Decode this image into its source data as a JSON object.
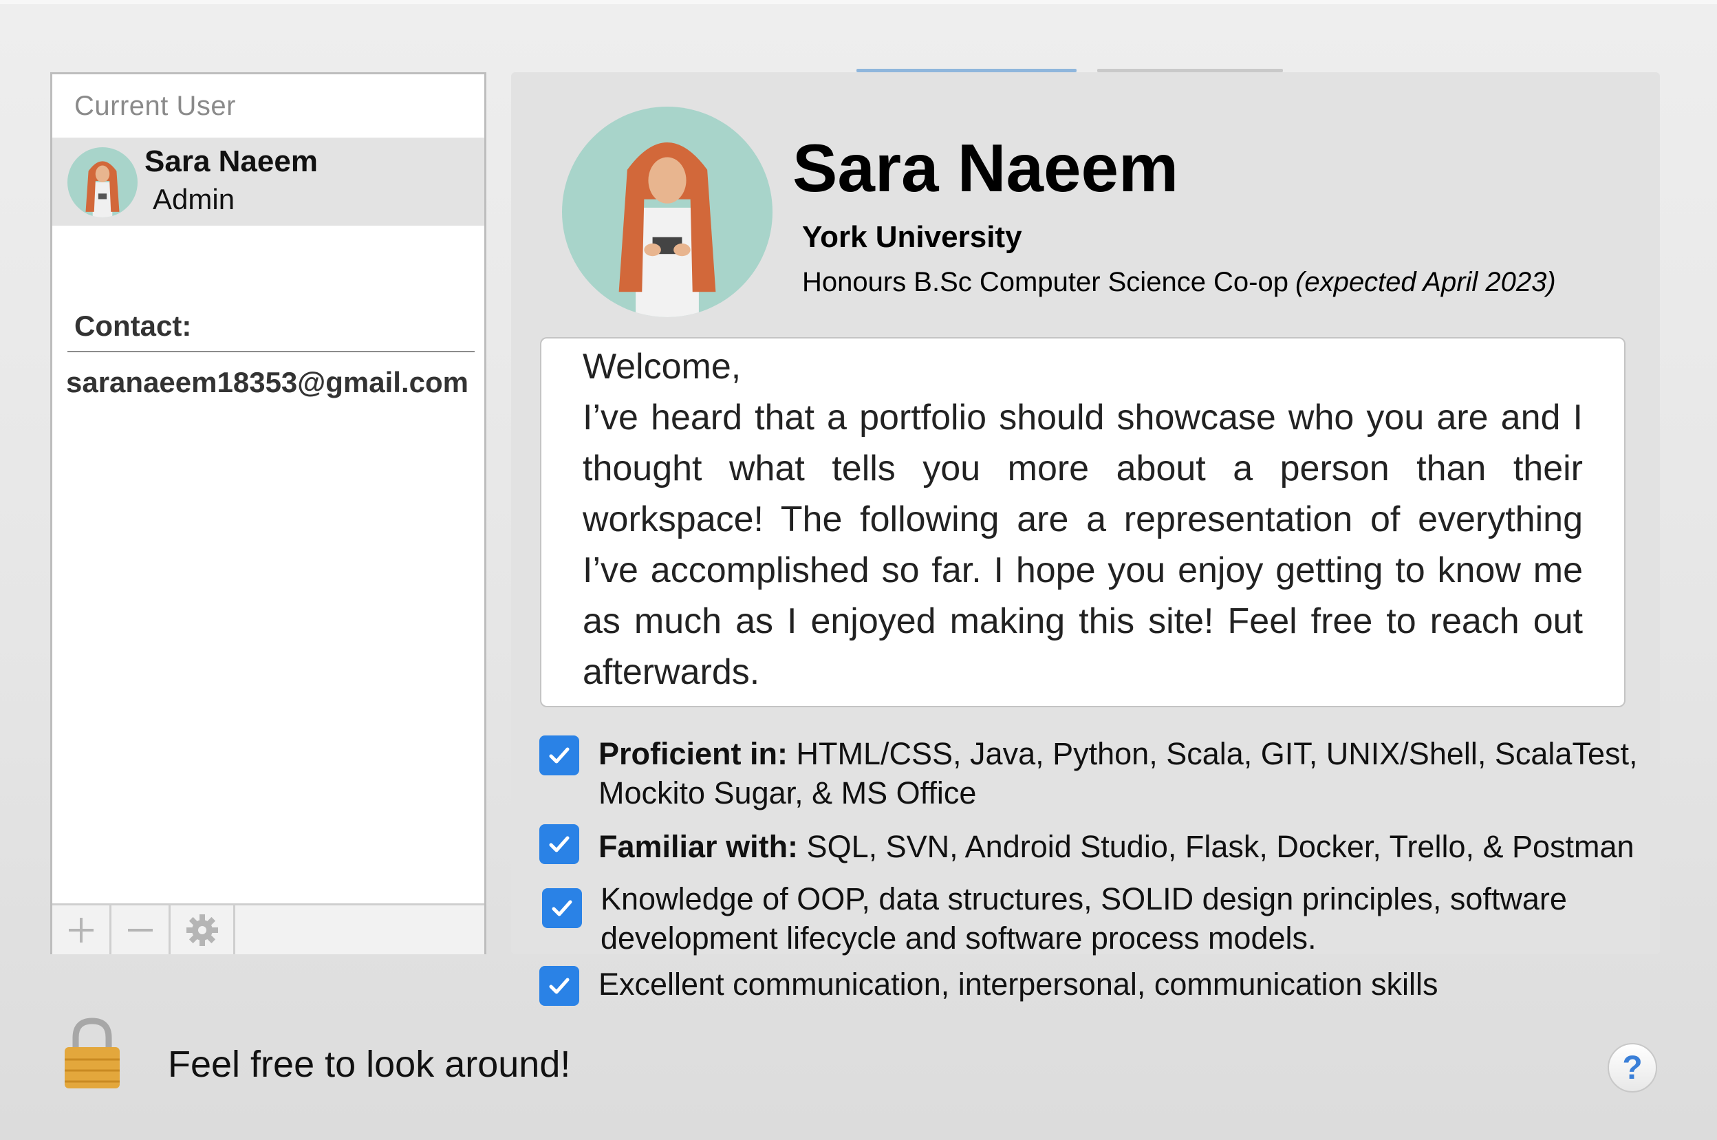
{
  "sidebar": {
    "heading": "Current User",
    "user": {
      "name": "Sara Naeem",
      "role": "Admin"
    },
    "contact_label": "Contact:",
    "email": "saranaeem18353@gmail.com",
    "toolbar": [
      "plus-icon",
      "minus-icon",
      "gear-icon"
    ]
  },
  "profile": {
    "name": "Sara Naeem",
    "school": "York University",
    "program": "Honours B.Sc Computer Science Co-op",
    "expected": "(expected April 2023)"
  },
  "welcome": {
    "title": "Welcome,",
    "body": "I’ve heard that a portfolio should showcase who you are and I thought what tells you more about a person than their workspace! The following are a representation of everything I’ve accomplished so far. I hope you enjoy getting to know me as much as I enjoyed making this site! Feel free to reach out afterwards."
  },
  "skills": [
    {
      "label": "Proficient in:",
      "text": " HTML/CSS, Java, Python, Scala, GIT, UNIX/Shell, ScalaTest, Mockito Sugar, & MS Office",
      "checked": true
    },
    {
      "label": "Familiar with:",
      "text": " SQL, SVN, Android Studio, Flask, Docker, Trello, & Postman",
      "checked": true
    },
    {
      "label": "",
      "text": "Knowledge of OOP, data structures, SOLID design principles, software development lifecycle and software process models.",
      "checked": true
    },
    {
      "label": "",
      "text": "Excellent communication, interpersonal, communication skills",
      "checked": true
    }
  ],
  "footer": {
    "lock_message": "Feel free to look around!",
    "help_label": "?"
  },
  "colors": {
    "checkbox": "#2a82e6",
    "avatar_bg": "#a8d4ca",
    "scarf": "#d2683a"
  }
}
